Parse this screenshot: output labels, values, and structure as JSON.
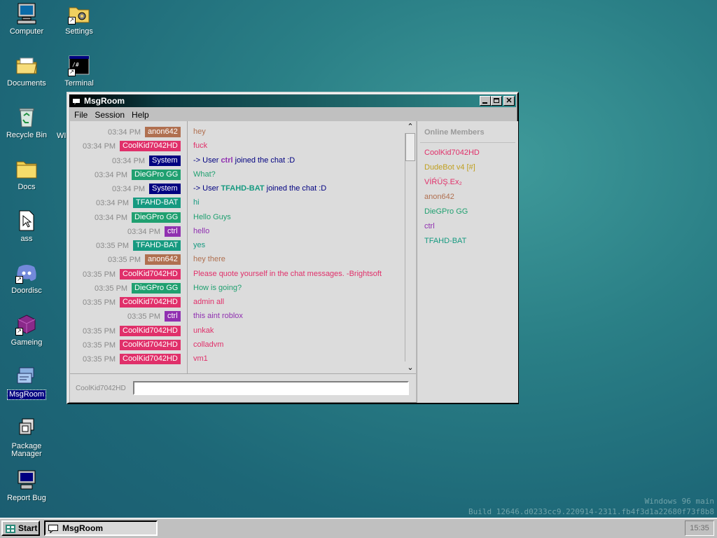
{
  "desktop": {
    "icons": [
      {
        "label": "Computer"
      },
      {
        "label": "Settings"
      },
      {
        "label": "Documents"
      },
      {
        "label": "Terminal"
      },
      {
        "label": "Recycle Bin"
      },
      {
        "label": "Docs"
      },
      {
        "label": "ass"
      },
      {
        "label": "Doordisc"
      },
      {
        "label": "Gameing"
      },
      {
        "label": "MsgRoom"
      },
      {
        "label": "Package Manager"
      },
      {
        "label": "Report Bug"
      }
    ],
    "partial_label": "WI"
  },
  "window": {
    "title": "MsgRoom",
    "menu": [
      "File",
      "Session",
      "Help"
    ],
    "controls": {
      "minimize": "_",
      "maximize": "□",
      "close": "×"
    }
  },
  "chat": {
    "messages": [
      {
        "time": "03:34 PM",
        "user": "anon642",
        "color": "#b07050",
        "text": "hey"
      },
      {
        "time": "03:34 PM",
        "user": "CoolKid7042HD",
        "color": "#e0306a",
        "text": "fuck"
      },
      {
        "time": "03:34 PM",
        "user": "System",
        "color": "#000080",
        "text_pre": "-> User ",
        "text_bold": "ctrl",
        "text_post": " joined the chat :D",
        "bold_color": "#9030b0"
      },
      {
        "time": "03:34 PM",
        "user": "DieGPro GG",
        "color": "#20a070",
        "text": "What?"
      },
      {
        "time": "03:34 PM",
        "user": "System",
        "color": "#000080",
        "text_pre": "-> User ",
        "text_bold": "TFAHD-BAT",
        "text_post": " joined the chat :D",
        "bold_color": "#169a80"
      },
      {
        "time": "03:34 PM",
        "user": "TFAHD-BAT",
        "color": "#169a80",
        "text": "hi"
      },
      {
        "time": "03:34 PM",
        "user": "DieGPro GG",
        "color": "#20a070",
        "text": "Hello Guys"
      },
      {
        "time": "03:34 PM",
        "user": "ctrl",
        "color": "#9030b0",
        "text": "hello"
      },
      {
        "time": "03:35 PM",
        "user": "TFAHD-BAT",
        "color": "#169a80",
        "text": "yes"
      },
      {
        "time": "03:35 PM",
        "user": "anon642",
        "color": "#b07050",
        "text": "hey there"
      },
      {
        "time": "03:35 PM",
        "user": "CoolKid7042HD",
        "color": "#e0306a",
        "text": "Please quote yourself in the chat messages. -Brightsoft"
      },
      {
        "time": "03:35 PM",
        "user": "DieGPro GG",
        "color": "#20a070",
        "text": "How is going?"
      },
      {
        "time": "03:35 PM",
        "user": "CoolKid7042HD",
        "color": "#e0306a",
        "text": "admin all"
      },
      {
        "time": "03:35 PM",
        "user": "ctrl",
        "color": "#9030b0",
        "text": "this aint roblox"
      },
      {
        "time": "03:35 PM",
        "user": "CoolKid7042HD",
        "color": "#e0306a",
        "text": "unkak"
      },
      {
        "time": "03:35 PM",
        "user": "CoolKid7042HD",
        "color": "#e0306a",
        "text": "colladvm"
      },
      {
        "time": "03:35 PM",
        "user": "CoolKid7042HD",
        "color": "#e0306a",
        "text": "vm1"
      }
    ],
    "input_nick": "CoolKid7042HD",
    "input_value": ""
  },
  "members": {
    "heading": "Online Members",
    "list": [
      {
        "name": "CoolKid7042HD",
        "color": "#e0306a"
      },
      {
        "name": "DudeBot v4 [#]",
        "color": "#c0a020"
      },
      {
        "name": "VİŔÜŞ.Ex₂",
        "color": "#e0306a"
      },
      {
        "name": "anon642",
        "color": "#b07050"
      },
      {
        "name": "DieGPro GG",
        "color": "#20a070"
      },
      {
        "name": "ctrl",
        "color": "#9030b0"
      },
      {
        "name": "TFAHD-BAT",
        "color": "#169a80"
      }
    ]
  },
  "watermark": {
    "line1": "Windows 96 main",
    "line2": "Build 12646.d0233cc9.220914-2311.fb4f3d1a22680f73f8b8"
  },
  "taskbar": {
    "start_label": "Start",
    "tasks": [
      {
        "label": "MsgRoom"
      }
    ],
    "clock": "15:35"
  }
}
